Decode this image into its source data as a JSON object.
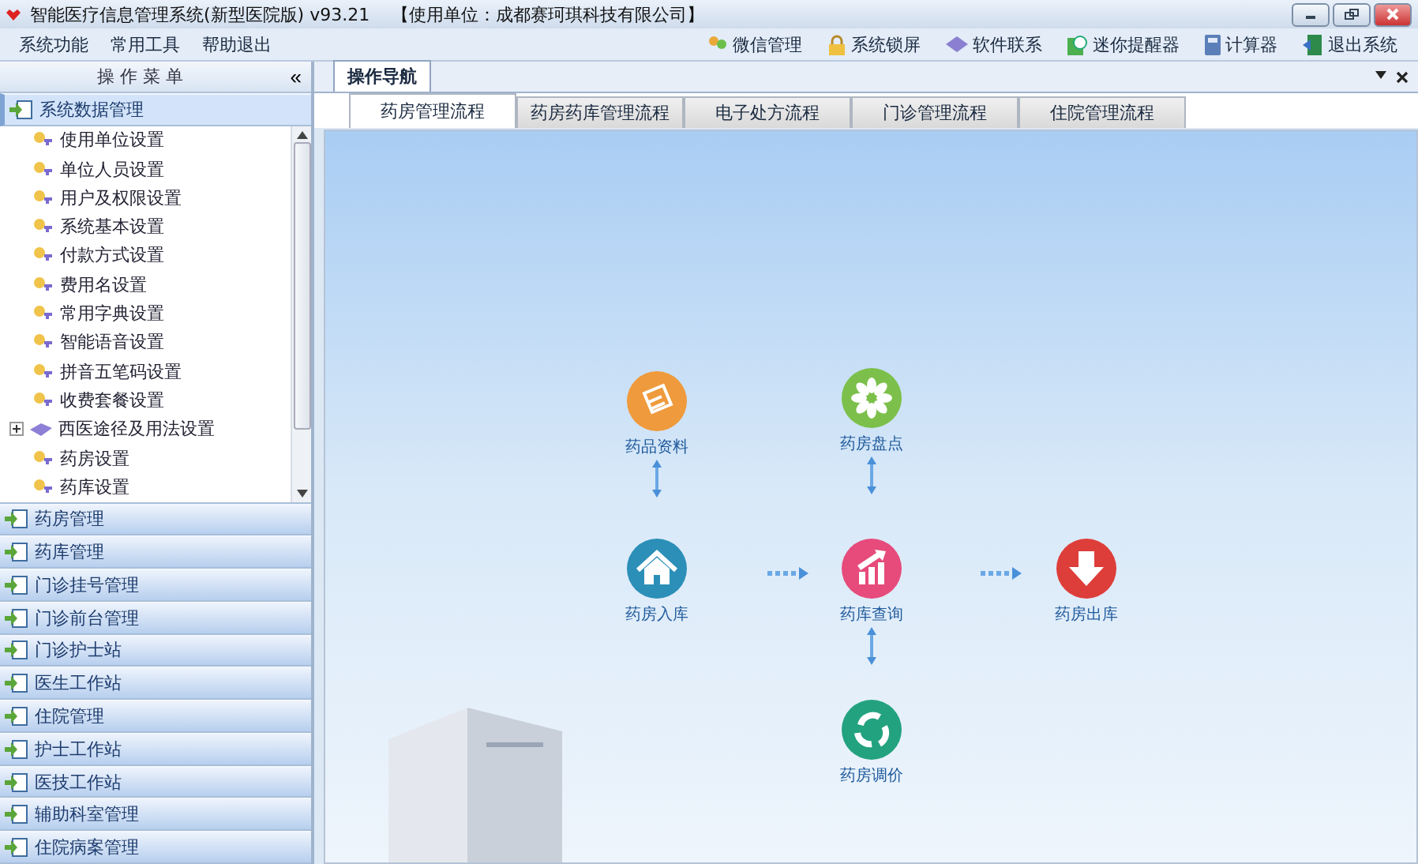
{
  "window": {
    "title": "智能医疗信息管理系统(新型医院版) v93.21",
    "organization": "【使用单位：成都赛珂琪科技有限公司】"
  },
  "menu": [
    "系统功能",
    "常用工具",
    "帮助退出"
  ],
  "toolbar": [
    "微信管理",
    "系统锁屏",
    "软件联系",
    "迷你提醒器",
    "计算器",
    "退出系统"
  ],
  "sidebar": {
    "title": "操 作 菜 单",
    "collapse": "«",
    "groups": [
      {
        "label": "系统数据管理",
        "selected": true,
        "children": [
          {
            "label": "使用单位设置"
          },
          {
            "label": "单位人员设置"
          },
          {
            "label": "用户及权限设置"
          },
          {
            "label": "系统基本设置"
          },
          {
            "label": "付款方式设置"
          },
          {
            "label": "费用名设置"
          },
          {
            "label": "常用字典设置"
          },
          {
            "label": "智能语音设置"
          },
          {
            "label": "拼音五笔码设置"
          },
          {
            "label": "收费套餐设置"
          },
          {
            "label": "西医途径及用法设置",
            "expanded": false
          },
          {
            "label": "药房设置"
          },
          {
            "label": "药库设置"
          }
        ]
      },
      {
        "label": "药房管理",
        "selected": false
      },
      {
        "label": "药库管理",
        "selected": false
      },
      {
        "label": "门诊挂号管理",
        "selected": false
      },
      {
        "label": "门诊前台管理",
        "selected": false
      },
      {
        "label": "门诊护士站",
        "selected": false
      },
      {
        "label": "医生工作站",
        "selected": false
      },
      {
        "label": "住院管理",
        "selected": false
      },
      {
        "label": "护士工作站",
        "selected": false
      },
      {
        "label": "医技工作站",
        "selected": false
      },
      {
        "label": "辅助科室管理",
        "selected": false
      },
      {
        "label": "住院病案管理",
        "selected": false
      }
    ]
  },
  "doc_tabs": [
    {
      "label": "操作导航",
      "selected": true
    }
  ],
  "flow_tabs": [
    {
      "label": "药房管理流程",
      "selected": true
    },
    {
      "label": "药房药库管理流程",
      "selected": false
    },
    {
      "label": "电子处方流程",
      "selected": false
    },
    {
      "label": "门诊管理流程",
      "selected": false
    },
    {
      "label": "住院管理流程",
      "selected": false
    }
  ],
  "flow_nodes": [
    {
      "label": "药品资料"
    },
    {
      "label": "药房盘点"
    },
    {
      "label": "药房入库"
    },
    {
      "label": "药库查询"
    },
    {
      "label": "药房出库"
    },
    {
      "label": "药房调价"
    }
  ]
}
